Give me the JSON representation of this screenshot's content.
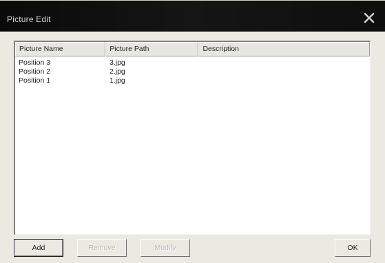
{
  "window": {
    "title": "Picture Edit"
  },
  "listview": {
    "columns": [
      "Picture Name",
      "Picture Path",
      "Description"
    ],
    "rows": [
      {
        "name": "Position 3",
        "path": "3.jpg",
        "description": ""
      },
      {
        "name": "Position 2",
        "path": "2.jpg",
        "description": ""
      },
      {
        "name": "Position 1",
        "path": "1.jpg",
        "description": ""
      }
    ]
  },
  "buttons": {
    "add": "Add",
    "remove": "Remove",
    "modify": "Modify",
    "ok": "OK"
  },
  "icons": {
    "close": "close-icon"
  }
}
